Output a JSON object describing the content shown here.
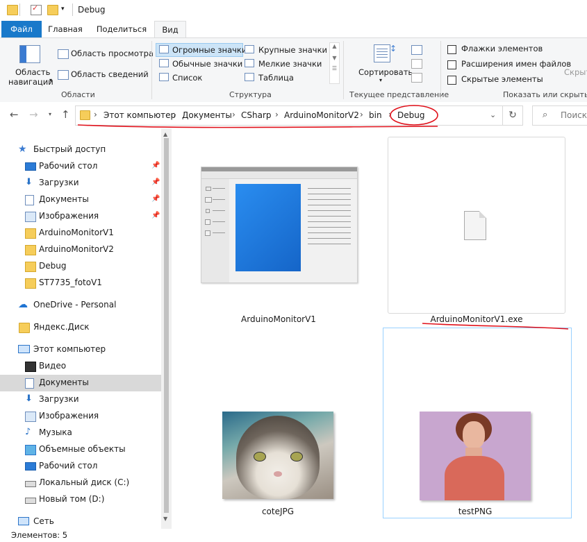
{
  "window": {
    "title": "Debug"
  },
  "tabs": [
    {
      "label": "Файл"
    },
    {
      "label": "Главная"
    },
    {
      "label": "Поделиться"
    },
    {
      "label": "Вид"
    }
  ],
  "ribbon": {
    "nav_pane_label": "Область\nнавигации",
    "nav_pane_line1": "Область",
    "nav_pane_line2": "навигации",
    "preview_pane": "Область просмотра",
    "details_pane": "Область сведений",
    "group_areas": "Области",
    "layouts": {
      "huge_icons": "Огромные значки",
      "large_icons": "Крупные значки",
      "medium_icons": "Обычные значки",
      "small_icons": "Мелкие значки",
      "list": "Список",
      "table": "Таблица"
    },
    "group_structure": "Структура",
    "sort": "Сортировать",
    "group_current_view": "Текущее представление",
    "item_checkboxes": "Флажки элементов",
    "file_extensions": "Расширения имен файлов",
    "hidden_items": "Скрытые элементы",
    "hide_selected": "Скрыть",
    "group_show_hide": "Показать или скрыть"
  },
  "address": {
    "crumbs": [
      "Этот компьютер",
      "Документы",
      "CSharp",
      "ArduinoMonitorV2",
      "bin",
      "Debug"
    ],
    "search_placeholder": "Поиск"
  },
  "sidebar": {
    "quick_access": "Быстрый доступ",
    "quick_items": [
      {
        "label": "Рабочий стол",
        "icon": "desktop-icon",
        "pinned": true
      },
      {
        "label": "Загрузки",
        "icon": "download-icon",
        "pinned": true
      },
      {
        "label": "Документы",
        "icon": "documents-icon",
        "pinned": true
      },
      {
        "label": "Изображения",
        "icon": "pictures-icon",
        "pinned": true
      },
      {
        "label": "ArduinoMonitorV1",
        "icon": "folder-icon",
        "pinned": false
      },
      {
        "label": "ArduinoMonitorV2",
        "icon": "folder-icon",
        "pinned": false
      },
      {
        "label": "Debug",
        "icon": "folder-icon",
        "pinned": false
      },
      {
        "label": "ST7735_fotoV1",
        "icon": "folder-icon",
        "pinned": false
      }
    ],
    "onedrive": "OneDrive - Personal",
    "yandex": "Яндекс.Диск",
    "this_pc": "Этот компьютер",
    "pc_items": [
      {
        "label": "Видео",
        "icon": "video-icon"
      },
      {
        "label": "Документы",
        "icon": "documents-icon"
      },
      {
        "label": "Загрузки",
        "icon": "download-icon"
      },
      {
        "label": "Изображения",
        "icon": "pictures-icon"
      },
      {
        "label": "Музыка",
        "icon": "music-icon"
      },
      {
        "label": "Объемные объекты",
        "icon": "3d-objects-icon"
      },
      {
        "label": "Рабочий стол",
        "icon": "desktop-icon"
      },
      {
        "label": "Локальный диск (C:)",
        "icon": "drive-icon"
      },
      {
        "label": "Новый том (D:)",
        "icon": "drive-icon"
      }
    ],
    "network": "Сеть"
  },
  "files": [
    {
      "name": "ArduinoMonitorV1",
      "type": "application"
    },
    {
      "name": "ArduinoMonitorV1.exe",
      "type": "generic-file"
    },
    {
      "name": "coteJPG",
      "type": "image"
    },
    {
      "name": "testPNG",
      "type": "image"
    }
  ],
  "status": {
    "count_text": "Элементов: 5"
  },
  "colors": {
    "accent": "#1979ca",
    "annotation": "#e0101a",
    "selection": "#d9d9d9"
  }
}
